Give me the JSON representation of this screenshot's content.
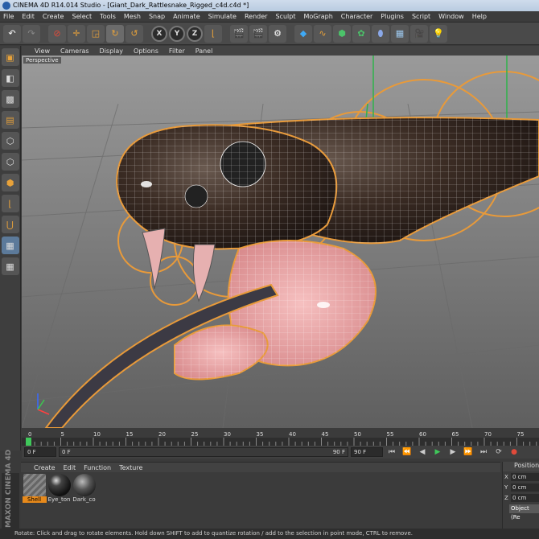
{
  "window": {
    "title": "CINEMA 4D R14.014 Studio - [Giant_Dark_Rattlesnake_Rigged_c4d.c4d *]"
  },
  "menu": [
    "File",
    "Edit",
    "Create",
    "Select",
    "Tools",
    "Mesh",
    "Snap",
    "Animate",
    "Simulate",
    "Render",
    "Sculpt",
    "MoGraph",
    "Character",
    "Plugins",
    "Script",
    "Window",
    "Help"
  ],
  "toolbar": {
    "axis": {
      "x": "X",
      "y": "Y",
      "z": "Z"
    },
    "icons": [
      "undo-icon",
      "redo-icon",
      "live-selection-icon",
      "move-icon",
      "scale-icon",
      "rotate-icon",
      "recent-tool-icon",
      "x-axis-icon",
      "y-axis-icon",
      "z-axis-icon",
      "coordinate-system-icon",
      "render-view-icon",
      "render-to-picture-viewer-icon",
      "edit-render-settings-icon",
      "cube-icon",
      "spline-icon",
      "nurbs-icon",
      "array-icon",
      "deformer-icon",
      "floor-icon",
      "camera-icon",
      "light-icon"
    ]
  },
  "viewport": {
    "menu": [
      "View",
      "Cameras",
      "Display",
      "Options",
      "Filter",
      "Panel"
    ],
    "label": "Perspective"
  },
  "timeline": {
    "ticks": [
      "0",
      "5",
      "10",
      "15",
      "20",
      "25",
      "30",
      "35",
      "40",
      "45",
      "50",
      "55",
      "60",
      "65",
      "70",
      "75"
    ],
    "start_field": "0 F",
    "range_start": "0 F",
    "range_end": "90 F",
    "end_field": "90 F"
  },
  "materials": {
    "menu": [
      "Create",
      "Edit",
      "Function",
      "Texture"
    ],
    "items": [
      {
        "name": "Shell",
        "active": true
      },
      {
        "name": "Eye_ton",
        "active": false
      },
      {
        "name": "Dark_co",
        "active": false
      }
    ]
  },
  "branding": "MAXON CINEMA 4D",
  "attributes": {
    "header": "Position",
    "rows": [
      {
        "axis": "X",
        "value": "0 cm"
      },
      {
        "axis": "Y",
        "value": "0 cm"
      },
      {
        "axis": "Z",
        "value": "0 cm"
      }
    ],
    "mode": "Object (Re"
  },
  "status": "Rotate: Click and drag to rotate elements. Hold down SHIFT to add to quantize rotation / add to the selection in point mode, CTRL to remove."
}
